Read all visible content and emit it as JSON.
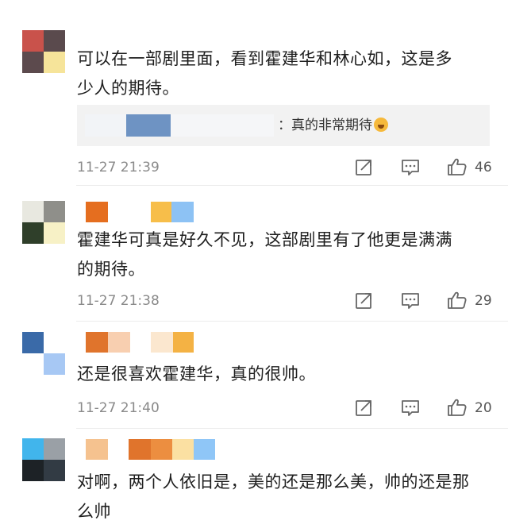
{
  "comments": [
    {
      "text_line1": "可以在一部剧里面，看到霍建华和林心如，这是多",
      "text_line2": "少人的期待。",
      "reply_text": "：真的非常期待",
      "time": "11-27 21:39",
      "likes": "46"
    },
    {
      "text_line1": "霍建华可真是好久不见，这部剧里有了他更是满满",
      "text_line2": "的期待。",
      "time": "11-27 21:38",
      "likes": "29"
    },
    {
      "text_line1": "还是很喜欢霍建华，真的很帅。",
      "time": "11-27 21:40",
      "likes": "20"
    },
    {
      "text_line1": "对啊，两个人依旧是，美的还是那么美，帅的还是那",
      "text_line2": "么帅"
    }
  ],
  "icons": {
    "share": "share-icon",
    "comment": "comment-icon",
    "like": "thumbs-up-icon",
    "emoji": "emoji-icon"
  },
  "colors": {
    "avatar1": [
      "#c9524b",
      "#5a4a4d",
      "#5c4a4d",
      "#f6e49a"
    ],
    "avatar2": [
      "#e8e8e0",
      "#8f8f8a",
      "#2f3f2a",
      "#f7f1c6"
    ],
    "avatar3": [
      "#3a6aa8",
      "#ffffff",
      "#ffffff",
      "#a7c8f4"
    ],
    "avatar4": [
      "#41b5ec",
      "#9aa0a6",
      "#1d2226",
      "#323b44"
    ],
    "name_mask2": [
      "#e56e1f",
      "#ffffff",
      "#f7be4a",
      "#8dc2f4"
    ],
    "name_mask3": [
      "#e0742c",
      "#f8cfb0",
      "#ffffff",
      "#fbe7cf",
      "#f4b244"
    ],
    "name_mask4": [
      "#f5c28f",
      "#ffffff",
      "#e0742c",
      "#ec8e40",
      "#fbe0a2",
      "#8fc6f7"
    ],
    "reply_mask": [
      "#f2f4f7",
      "#6e93c3",
      "#f5f6f8"
    ]
  }
}
